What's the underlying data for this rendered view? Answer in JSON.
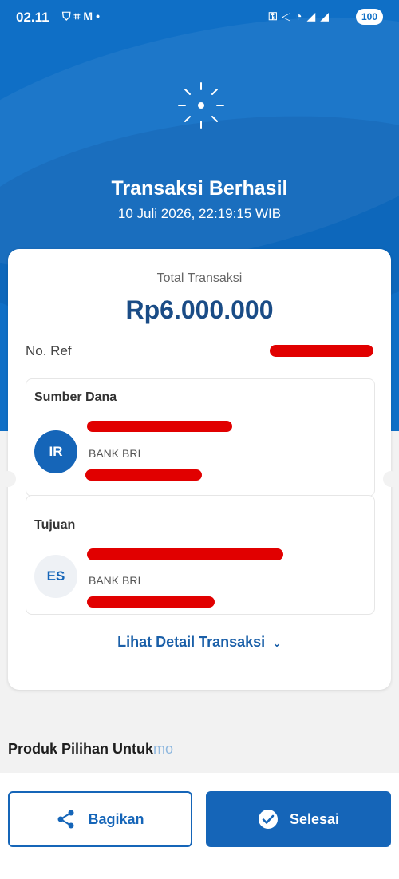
{
  "status_bar": {
    "time": "02.11",
    "left_icons": [
      "shield-icon",
      "scan-icon",
      "mail-icon",
      "dot-icon"
    ],
    "right_icons": [
      "key-icon",
      "mute-icon",
      "wifi-icon",
      "signal-icon",
      "signal-icon"
    ],
    "battery": "100"
  },
  "header": {
    "title": "Transaksi Berhasil",
    "datetime": "10 Juli 2026, 22:19:15 WIB"
  },
  "receipt": {
    "total_label": "Total Transaksi",
    "total_amount": "Rp6.000.000",
    "ref_label": "No. Ref",
    "source": {
      "title": "Sumber Dana",
      "initials": "IR",
      "bank": "BANK BRI"
    },
    "destination": {
      "title": "Tujuan",
      "initials": "ES",
      "bank": "BANK BRI"
    },
    "detail_link": "Lihat Detail Transaksi"
  },
  "products": {
    "title_main": "Produk Pilihan Untuk",
    "title_tail": "mo"
  },
  "actions": {
    "share_label": "Bagikan",
    "done_label": "Selesai"
  },
  "colors": {
    "primary": "#0f6fc6",
    "amount": "#1a4c86",
    "redaction": "#e10000"
  }
}
